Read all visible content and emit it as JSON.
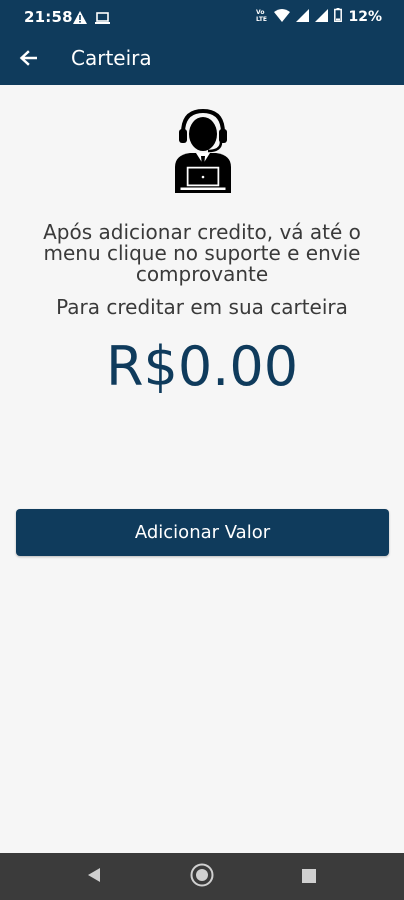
{
  "status_bar": {
    "time": "21:58",
    "battery_percent": "12%",
    "left_icons": [
      "warning-icon",
      "laptop-icon"
    ],
    "right_icons": [
      "volte-icon",
      "wifi-icon",
      "signal-icon",
      "signal-icon",
      "battery-icon"
    ]
  },
  "app_bar": {
    "title": "Carteira",
    "back_icon": "arrow-left-icon"
  },
  "content": {
    "message_line1": "Após adicionar credito, vá até o menu clique no suporte e envie comprovante",
    "message_line2": "Para creditar em sua carteira",
    "balance": "R$0.00",
    "add_button_label": "Adicionar Valor"
  },
  "nav_bar": {
    "buttons": [
      "back-triangle-icon",
      "home-circle-icon",
      "recents-square-icon"
    ]
  },
  "colors": {
    "primary": "#0f3b5c",
    "background": "#f6f6f6",
    "nav_bar": "#3b3b3b"
  }
}
